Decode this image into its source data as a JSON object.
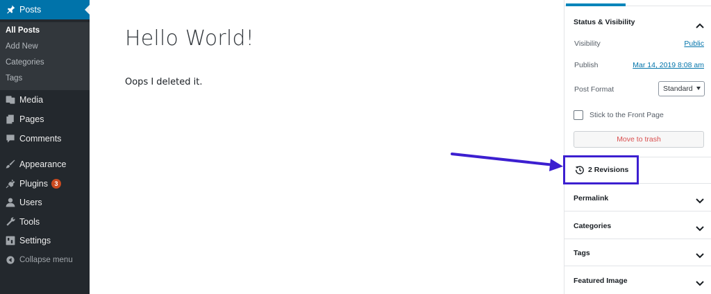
{
  "sidebar": {
    "posts": "Posts",
    "submenu": {
      "all_posts": "All Posts",
      "add_new": "Add New",
      "categories": "Categories",
      "tags": "Tags"
    },
    "media": "Media",
    "pages": "Pages",
    "comments": "Comments",
    "appearance": "Appearance",
    "plugins": "Plugins",
    "plugins_badge": "3",
    "users": "Users",
    "tools": "Tools",
    "settings": "Settings",
    "collapse": "Collapse menu"
  },
  "editor": {
    "title": "Hello World!",
    "body": "Oops I deleted it."
  },
  "settings_panel": {
    "status_title": "Status & Visibility",
    "visibility_label": "Visibility",
    "visibility_value": "Public",
    "publish_label": "Publish",
    "publish_value": "Mar 14, 2019 8:08 am",
    "format_label": "Post Format",
    "format_value": "Standard",
    "sticky_label": "Stick to the Front Page",
    "trash_label": "Move to trash",
    "revisions_label": "2 Revisions",
    "permalink_title": "Permalink",
    "categories_title": "Categories",
    "tags_title": "Tags",
    "featured_title": "Featured Image"
  },
  "colors": {
    "admin_bg": "#23282d",
    "active_blue": "#0073aa",
    "annotation": "#3c1fd0",
    "trash_red": "#d94f4f"
  }
}
